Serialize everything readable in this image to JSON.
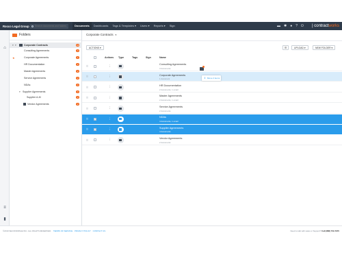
{
  "topbar": {
    "brand": "Rocco Legal Group",
    "search_placeholder": "Search documents and folders",
    "nav": [
      "Documents",
      "Dashboards",
      "Tags & Templates ▾",
      "Users ▾",
      "Reports ▾",
      "Sign"
    ],
    "icons": [
      "inbox-icon",
      "gear-icon",
      "person-icon",
      "help-icon",
      "power-icon"
    ],
    "logo_main": "contract",
    "logo_accent": "works",
    "logo_divider": "|"
  },
  "rail": {
    "icons": [
      "home-icon",
      "settings-sliders-icon",
      "trash-icon"
    ]
  },
  "folders": {
    "title": "Folders",
    "tree": [
      {
        "label": "Corporate Contracts",
        "count": "13",
        "level": 0,
        "selected": true
      },
      {
        "label": "Consulting Agreements",
        "count": "3",
        "level": 2
      },
      {
        "label": "Corporate Agreements",
        "count": "1",
        "level": 2,
        "star": true
      },
      {
        "label": "HR Documentation",
        "count": "2",
        "level": 2
      },
      {
        "label": "Master Agreements",
        "count": "2",
        "level": 2
      },
      {
        "label": "Service Agreements",
        "count": "2",
        "level": 2
      },
      {
        "label": "NDAs",
        "count": "4",
        "level": 2
      },
      {
        "label": "Supplier Agreements",
        "count": "4",
        "level": 1
      },
      {
        "label": "Supplier A-M",
        "count": "2",
        "level": 3
      },
      {
        "label": "Vendor Agreements",
        "count": "2",
        "level": 2
      }
    ]
  },
  "main": {
    "breadcrumb": "Corporate Contracts",
    "actions_label": "ACTIONS ▾",
    "upload_label": "UPLOAD ▾",
    "new_folder_label": "NEW FOLDER ▾",
    "columns": [
      "Actions",
      "Type",
      "Tags",
      "Sign",
      "Name"
    ],
    "drag_label": "Move 2 items",
    "rows": [
      {
        "name": "Consulting Agreements",
        "sub": "3 documents",
        "state": "normal"
      },
      {
        "name": "Corporate Agreements",
        "sub": "1 document",
        "state": "hover"
      },
      {
        "name": "HR Documentation",
        "sub": "2 documents, 1 email",
        "state": "normal"
      },
      {
        "name": "Master Agreements",
        "sub": "2 documents, 1 email",
        "state": "normal"
      },
      {
        "name": "Service Agreements",
        "sub": "2 documents",
        "state": "normal"
      },
      {
        "name": "NDAs",
        "sub": "4 documents, 1 email",
        "state": "selected"
      },
      {
        "name": "Supplier Agreements",
        "sub": "4 documents",
        "state": "selected"
      },
      {
        "name": "Vendor Agreements",
        "sub": "2 documents",
        "state": "normal"
      }
    ]
  },
  "footer": {
    "copyright": "©2019 SECONDPAGE INC. ALL RIGHTS RESERVED.",
    "links": [
      "TERMS OF SERVICE",
      "PRIVACY POLICY",
      "CONTACT US"
    ],
    "help_text": "Need to talk with sales or Support?",
    "phone": "Call (888) 709-7970"
  }
}
